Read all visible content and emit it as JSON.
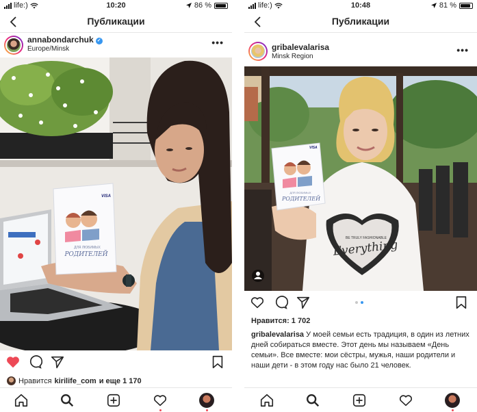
{
  "left_phone": {
    "status": {
      "carrier": "life:)",
      "time": "10:20",
      "battery": "86 %",
      "battery_level": 0.86
    },
    "nav_title": "Публикации",
    "post": {
      "username": "annabondarchuk",
      "location": "Europe/Minsk",
      "booklet": {
        "brand": "VISA",
        "line1": "ДЛЯ ЛЮБИМЫХ",
        "line2": "РОДИТЕЛЕЙ"
      },
      "likes_prefix": "Нравится",
      "likes_user": "kirilife_com",
      "likes_suffix": "и еще 1 170",
      "liked": true
    }
  },
  "right_phone": {
    "status": {
      "carrier": "life:)",
      "time": "10:48",
      "battery": "81 %",
      "battery_level": 0.81
    },
    "nav_title": "Публикации",
    "post": {
      "username": "gribalevalarisa",
      "location": "Minsk Region",
      "booklet": {
        "brand": "VISA",
        "line1": "ДЛЯ ЛЮБИМЫХ",
        "line2": "РОДИТЕЛЕЙ"
      },
      "shirt_text": "Everything",
      "shirt_small": "BE TRULY FASHIONABLE",
      "likes": "Нравится: 1 702",
      "caption_user": "gribalevalarisa",
      "caption_text": "У моей семьи есть традиция, в один из летних дней собираться вместе. Этот день мы называем «День семьи». Все вместе: мои сёстры, мужья, наши родители и наши дети - в этом году нас было 21 человек.",
      "carousel_pages": 2,
      "carousel_active": 2
    }
  },
  "colors": {
    "like_red": "#ed4956",
    "accent_blue": "#3897f0",
    "text": "#262626",
    "divider": "#e6e6e6"
  }
}
